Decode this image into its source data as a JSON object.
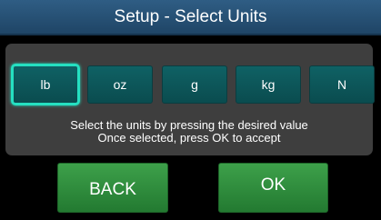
{
  "header": {
    "title": "Setup - Select Units"
  },
  "units": [
    {
      "label": "lb",
      "selected": true
    },
    {
      "label": "oz",
      "selected": false
    },
    {
      "label": "g",
      "selected": false
    },
    {
      "label": "kg",
      "selected": false
    },
    {
      "label": "N",
      "selected": false
    }
  ],
  "instructions": {
    "line1": "Select the units by pressing the desired value",
    "line2": "Once selected, press OK to accept"
  },
  "actions": {
    "back_label": "BACK",
    "ok_label": "OK"
  },
  "colors": {
    "title_bar": "#2a5478",
    "panel": "#3e3e3e",
    "unit_button": "#0d5a5d",
    "selected_outline": "#25e0c1",
    "action_button": "#2e8d3c"
  }
}
